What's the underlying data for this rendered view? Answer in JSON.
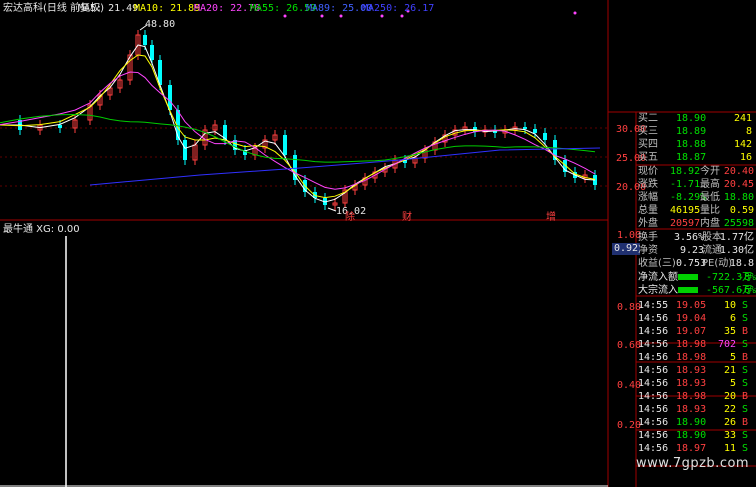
{
  "header": {
    "title": "宏达高科(日线 前复权)",
    "ma5": "MA5: 21.49",
    "ma10": "MA10: 21.89",
    "ma20": "MA20: 22.76",
    "ma55": "MA55: 26.59",
    "ma89": "MA89: 25.00",
    "ma250": "MA250: 26.17"
  },
  "main_chart": {
    "high_label": "48.80",
    "low_label": "16.02",
    "price_ticks": [
      "30.00",
      "25.00",
      "20.00"
    ],
    "event_marks": [
      "除",
      "财",
      "增"
    ]
  },
  "indicator": {
    "title": "最牛通 XG: 0.00",
    "ticks": [
      "1.00",
      "0.92",
      "0.80",
      "0.60",
      "0.40",
      "0.20"
    ]
  },
  "order_book": [
    {
      "label": "买二",
      "price": "18.90",
      "vol": "241"
    },
    {
      "label": "买三",
      "price": "18.89",
      "vol": "8"
    },
    {
      "label": "买四",
      "price": "18.88",
      "vol": "142"
    },
    {
      "label": "买五",
      "price": "18.87",
      "vol": "16"
    }
  ],
  "quote": [
    {
      "l1": "现价",
      "v1": "18.92",
      "l2": "今开",
      "v2": "20.40"
    },
    {
      "l1": "涨跌",
      "v1": "-1.71",
      "l2": "最高",
      "v2": "20.45"
    },
    {
      "l1": "涨幅",
      "v1": "-8.29%",
      "l2": "最低",
      "v2": "18.80"
    },
    {
      "l1": "总量",
      "v1": "46195",
      "l2": "量比",
      "v2": "0.59"
    },
    {
      "l1": "外盘",
      "v1": "20597",
      "l2": "内盘",
      "v2": "25598"
    }
  ],
  "stats": [
    {
      "l1": "换手",
      "v1": "3.56%",
      "l2": "股本",
      "v2": "1.77亿"
    },
    {
      "l1": "净资",
      "v1": "9.23",
      "l2": "流通",
      "v2": "1.30亿"
    },
    {
      "l1": "收益(三)",
      "v1": "0.753",
      "l2": "PE(动)",
      "v2": "18.8"
    }
  ],
  "flows": [
    {
      "label": "净流入额",
      "value": "-722.3万",
      "pct": "-8%"
    },
    {
      "label": "大宗流入",
      "value": "-567.6万",
      "pct": "-6%"
    }
  ],
  "ticks": [
    {
      "t": "14:55",
      "p": "19.05",
      "v": "10",
      "s": "S"
    },
    {
      "t": "14:56",
      "p": "19.04",
      "v": "6",
      "s": "S"
    },
    {
      "t": "14:56",
      "p": "19.07",
      "v": "35",
      "s": "B"
    },
    {
      "t": "14:56",
      "p": "18.98",
      "v": "702",
      "s": "S"
    },
    {
      "t": "14:56",
      "p": "18.98",
      "v": "5",
      "s": "B"
    },
    {
      "t": "14:56",
      "p": "18.93",
      "v": "21",
      "s": "S"
    },
    {
      "t": "14:56",
      "p": "18.93",
      "v": "5",
      "s": "S"
    },
    {
      "t": "14:56",
      "p": "18.98",
      "v": "20",
      "s": "B"
    },
    {
      "t": "14:56",
      "p": "18.93",
      "v": "22",
      "s": "S"
    },
    {
      "t": "14:56",
      "p": "18.90",
      "v": "26",
      "s": "B"
    },
    {
      "t": "14:56",
      "p": "18.90",
      "v": "33",
      "s": "S"
    },
    {
      "t": "14:56",
      "p": "18.97",
      "v": "11",
      "s": "S"
    }
  ],
  "watermark": "www.7gpzb.com",
  "colors": {
    "up": "#ff4040",
    "down": "#00ffff",
    "green": "#00e000",
    "ma_white": "#ffffff",
    "ma_yellow": "#ffff00",
    "ma_magenta": "#ff44ff",
    "ma_green": "#00cc00",
    "ma_blue": "#3030ff",
    "grid_red": "#a00000"
  }
}
